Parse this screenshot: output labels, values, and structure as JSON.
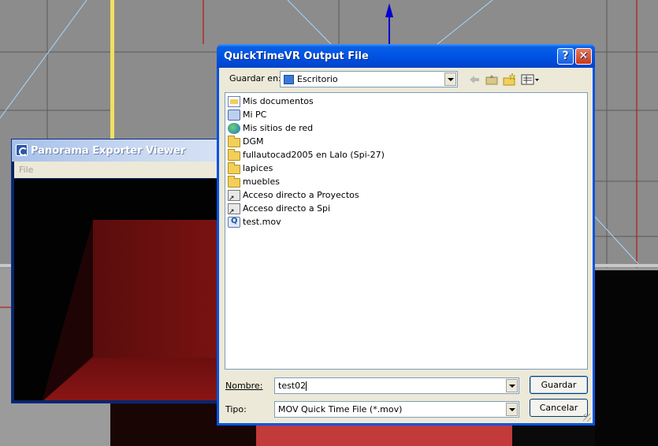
{
  "viewer": {
    "title": "Panorama Exporter Viewer",
    "menu": [
      "File"
    ],
    "icon": "app-icon"
  },
  "dialog": {
    "title": "QuickTimeVR Output File",
    "help_label": "?",
    "close_label": "✕",
    "save_in_label": "Guardar en:",
    "save_in_value": "Escritorio",
    "toolbar_icons": [
      "back-icon",
      "up-folder-icon",
      "new-folder-icon",
      "view-menu-icon"
    ],
    "files": [
      {
        "name": "Mis documentos",
        "icon": "my-documents-icon"
      },
      {
        "name": "Mi PC",
        "icon": "my-computer-icon"
      },
      {
        "name": "Mis sitios de red",
        "icon": "network-places-icon"
      },
      {
        "name": "DGM",
        "icon": "folder-icon"
      },
      {
        "name": "fullautocad2005 en Lalo (Spi-27)",
        "icon": "folder-icon"
      },
      {
        "name": "lapices",
        "icon": "folder-icon"
      },
      {
        "name": "muebles",
        "icon": "folder-icon"
      },
      {
        "name": "Acceso directo a Proyectos",
        "icon": "shortcut-icon"
      },
      {
        "name": "Acceso directo a Spi",
        "icon": "shortcut-icon"
      },
      {
        "name": "test.mov",
        "icon": "quicktime-file-icon"
      }
    ],
    "filename_label": "Nombre:",
    "filename_value": "test02",
    "filetype_label": "Tipo:",
    "filetype_value": "MOV Quick Time File (*.mov)",
    "save_button": "Guardar",
    "cancel_button": "Cancelar"
  },
  "colors": {
    "xp_blue": "#0054e3",
    "dialog_bg": "#ece9d8",
    "render_red": "#7a1010"
  }
}
